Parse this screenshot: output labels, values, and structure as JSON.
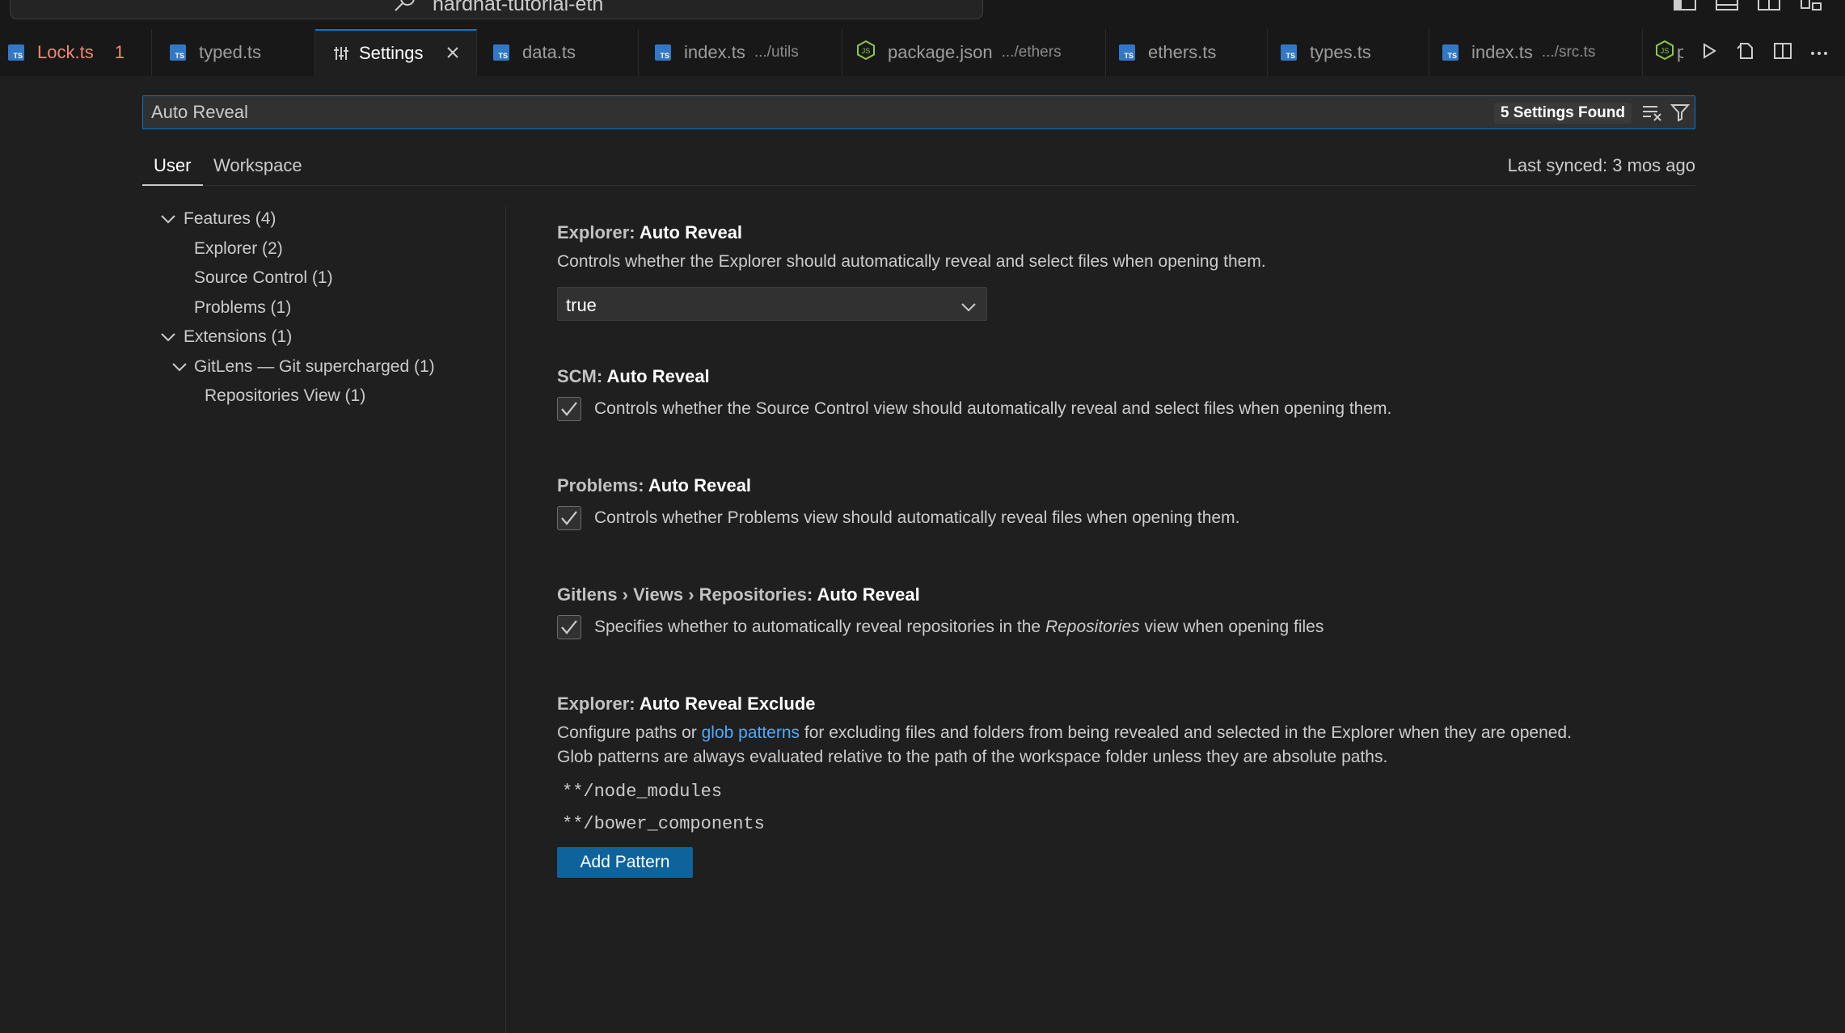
{
  "window": {
    "command_center_text": "hardhat-tutorial-eth"
  },
  "tabs": [
    {
      "label": "Lock.ts",
      "count": "1",
      "icon": "typescript-icon"
    },
    {
      "label": "typed.ts",
      "icon": "typescript-icon"
    },
    {
      "label": "Settings",
      "icon": "settings-icon"
    },
    {
      "label": "data.ts",
      "icon": "typescript-icon"
    },
    {
      "label": "index.ts",
      "path": ".../utils",
      "icon": "typescript-icon"
    },
    {
      "label": "package.json",
      "path": ".../ethers",
      "icon": "nodejs-icon"
    },
    {
      "label": "ethers.ts",
      "icon": "typescript-icon"
    },
    {
      "label": "types.ts",
      "icon": "typescript-icon"
    },
    {
      "label": "index.ts",
      "path": ".../src.ts",
      "icon": "typescript-icon"
    },
    {
      "label": "p",
      "icon": "nodejs-icon"
    }
  ],
  "search": {
    "value": "Auto Reveal",
    "result_count": "5 Settings Found"
  },
  "scope": {
    "user": "User",
    "workspace": "Workspace",
    "last_synced": "Last synced: 3 mos ago"
  },
  "toc": {
    "features": "Features (4)",
    "explorer": "Explorer (2)",
    "source_control": "Source Control (1)",
    "problems": "Problems (1)",
    "extensions": "Extensions (1)",
    "gitlens": "GitLens — Git supercharged (1)",
    "repositories_view": "Repositories View (1)"
  },
  "settings": [
    {
      "category": "Explorer: ",
      "name": "Auto Reveal",
      "description": "Controls whether the Explorer should automatically reveal and select files when opening them.",
      "value": "true"
    },
    {
      "category": "SCM: ",
      "name": "Auto Reveal",
      "description": "Controls whether the Source Control view should automatically reveal and select files when opening them.",
      "checked": true
    },
    {
      "category": "Problems: ",
      "name": "Auto Reveal",
      "description": "Controls whether Problems view should automatically reveal files when opening them.",
      "checked": true
    },
    {
      "category": "Gitlens › Views › Repositories: ",
      "name": "Auto Reveal",
      "description_before": "Specifies whether to automatically reveal repositories in the ",
      "description_em": "Repositories",
      "description_after": " view when opening files",
      "checked": true
    },
    {
      "category": "Explorer: ",
      "name": "Auto Reveal Exclude",
      "description_before": "Configure paths or ",
      "description_link": "glob patterns",
      "description_after": " for excluding files and folders from being revealed and selected in the Explorer when they are opened.",
      "description_line2": "Glob patterns are always evaluated relative to the path of the workspace folder unless they are absolute paths.",
      "patterns": [
        "**/node_modules",
        "**/bower_components"
      ],
      "add_button": "Add Pattern"
    }
  ],
  "colors": {
    "accent": "#0078d4",
    "button": "#0e639c",
    "link": "#4daafc",
    "error_tab": "#f48771",
    "typescript": "#3178c6"
  }
}
